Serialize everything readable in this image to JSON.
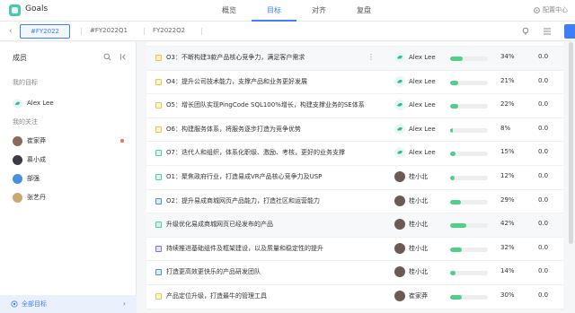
{
  "app": {
    "title": "Goals"
  },
  "nav": {
    "items": [
      {
        "label": "概览",
        "active": false
      },
      {
        "label": "目标",
        "active": true
      },
      {
        "label": "对齐",
        "active": false
      },
      {
        "label": "复盘",
        "active": false
      }
    ]
  },
  "settings_label": "配置中心",
  "periods": [
    {
      "label": "#FY2022",
      "active": true
    },
    {
      "label": "#FY2022Q1",
      "active": false
    },
    {
      "label": "FY2022Q2",
      "active": false
    }
  ],
  "sidebar": {
    "title": "成员",
    "my_goals_section": "我的目标",
    "me": {
      "name": "Alex Lee"
    },
    "following_section": "我的关注",
    "following": [
      {
        "name": "崔家莽",
        "has_dot": true,
        "color": "#8c6a5a"
      },
      {
        "name": "慕小成",
        "has_dot": false,
        "color": "#3b3b48"
      },
      {
        "name": "部强",
        "has_dot": false,
        "color": "#4a90e2"
      },
      {
        "name": "张艺丹",
        "has_dot": false,
        "color": "#c9a96e"
      }
    ],
    "footer_label": "全部目标"
  },
  "goals": [
    {
      "title": "O3：不断构建3款产品核心竞争力，满足客户需求",
      "owner": "Alex Lee",
      "owner_type": "alex",
      "progress": 34,
      "score": "0.0",
      "box_color": "#f5c542",
      "highlight": true
    },
    {
      "title": "O4：提升公司技术能力，支撑产品和业务更好发展",
      "owner": "Alex Lee",
      "owner_type": "alex",
      "progress": 21,
      "score": "0.0",
      "box_color": "#f5c542",
      "highlight": false
    },
    {
      "title": "O5：增长团队实现PingCode SQL100%增长，构建支撑业务的SE体系",
      "owner": "Alex Lee",
      "owner_type": "alex",
      "progress": 22,
      "score": "0.0",
      "box_color": "#f5c542",
      "highlight": false
    },
    {
      "title": "O6：构建服务体系，将服务逐步打造为竞争优势",
      "owner": "Alex Lee",
      "owner_type": "alex",
      "progress": 8,
      "score": "0.0",
      "box_color": "#f5c542",
      "highlight": false
    },
    {
      "title": "O7：迭代人和组织，体系化职级、激励、考核，更好的业务支撑",
      "owner": "Alex Lee",
      "owner_type": "alex",
      "progress": 15,
      "score": "0.0",
      "box_color": "#4fcfa2",
      "highlight": false
    },
    {
      "title": "O1：聚焦政府行业，打造易成VR产品核心竞争力及USP",
      "owner": "桂小北",
      "owner_type": "person",
      "progress": 12,
      "score": "0.0",
      "box_color": "#4fcfa2",
      "highlight": false
    },
    {
      "title": "O2：提升易成商城网页产品能力，打造社区和运营能力",
      "owner": "桂小北",
      "owner_type": "person",
      "progress": 29,
      "score": "0.0",
      "box_color": "#4a90e2",
      "highlight": false
    },
    {
      "title": "升级优化易成商城网页已经发布的产品",
      "owner": "桂小北",
      "owner_type": "person",
      "progress": 42,
      "score": "0.0",
      "box_color": "#4fcfa2",
      "highlight": true
    },
    {
      "title": "持续推进基础组件及框架建设，以及质量和稳定性的提升",
      "owner": "桂小北",
      "owner_type": "person",
      "progress": 32,
      "score": "0.0",
      "box_color": "#7b6cf6",
      "highlight": false
    },
    {
      "title": "打造更高效更快乐的产品研发团队",
      "owner": "桂小北",
      "owner_type": "person",
      "progress": 14,
      "score": "0.0",
      "box_color": "#4a90e2",
      "highlight": false
    },
    {
      "title": "产品定位升级，打造最牛的管理工具",
      "owner": "崔家莽",
      "owner_type": "person",
      "progress": 30,
      "score": "0.0",
      "box_color": "#f5c542",
      "highlight": false
    }
  ]
}
